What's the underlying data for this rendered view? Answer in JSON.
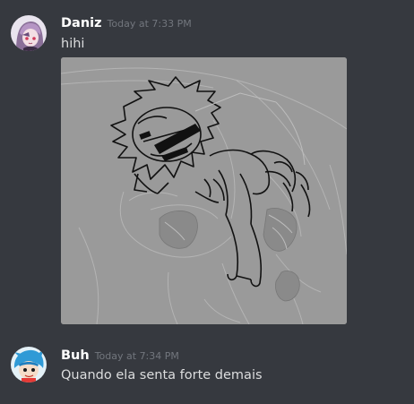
{
  "messages": [
    {
      "username": "Daniz",
      "timestamp": "Today at 7:33 PM",
      "content": "hihi",
      "avatar_icon": "anime-girl-avatar",
      "attachment": {
        "type": "image",
        "description_icon": "sketch-drawing-image"
      }
    },
    {
      "username": "Buh",
      "timestamp": "Today at 7:34 PM",
      "content": "Quando ela senta forte demais",
      "avatar_icon": "blue-hair-character-avatar"
    }
  ],
  "colors": {
    "background": "#36393f",
    "username": "#ffffff",
    "timestamp": "#72767d",
    "text": "#dcddde",
    "attachment_bg": "#9a9a9a"
  }
}
